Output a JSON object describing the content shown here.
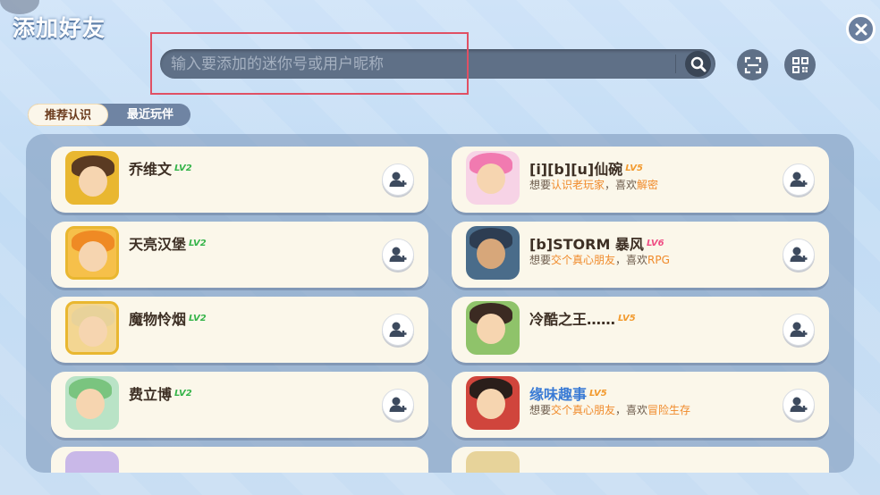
{
  "header": {
    "title": "添加好友"
  },
  "search": {
    "placeholder": "输入要添加的迷你号或用户昵称",
    "value": ""
  },
  "tabs": [
    {
      "label": "推荐认识",
      "active": true
    },
    {
      "label": "最近玩伴",
      "active": false
    }
  ],
  "colors": {
    "accent_highlight": "#e05064",
    "level_green": "#36b44a",
    "level_pink": "#ef4e84",
    "level_orange": "#f29a2e",
    "hobby_orange": "#f08a2a",
    "link_blue": "#3a7bd5"
  },
  "left_friends": [
    {
      "name": "乔维文",
      "level": "LV2",
      "level_color": "green"
    },
    {
      "name": "天亮汉堡",
      "level": "LV2",
      "level_color": "green"
    },
    {
      "name": "魔物怜烟",
      "level": "LV2",
      "level_color": "green"
    },
    {
      "name": "费立博",
      "level": "LV2",
      "level_color": "green"
    }
  ],
  "right_friends": [
    {
      "name": "[i][b][u]仙碗",
      "level": "LV5",
      "level_color": "orange",
      "desc_prefix": "想要",
      "desc_goal": "认识老玩家",
      "desc_mid": "，喜欢",
      "desc_hobby": "解密"
    },
    {
      "name": "[b]STORM 暴风",
      "level": "LV6",
      "level_color": "pink",
      "desc_prefix": "想要",
      "desc_goal": "交个真心朋友",
      "desc_mid": "，喜欢",
      "desc_hobby": "RPG"
    },
    {
      "name": "冷酷之王……",
      "level": "LV5",
      "level_color": "orange"
    },
    {
      "name": "缘味趣事",
      "level": "LV5",
      "level_color": "orange",
      "desc_prefix": "想要",
      "desc_goal": "交个真心朋友",
      "desc_mid": "，喜欢",
      "desc_hobby": "冒险生存"
    }
  ],
  "icons": {
    "close": "close-icon",
    "search": "search-icon",
    "scan": "scan-icon",
    "qr": "qr-code-icon",
    "add_friend": "add-friend-icon"
  }
}
